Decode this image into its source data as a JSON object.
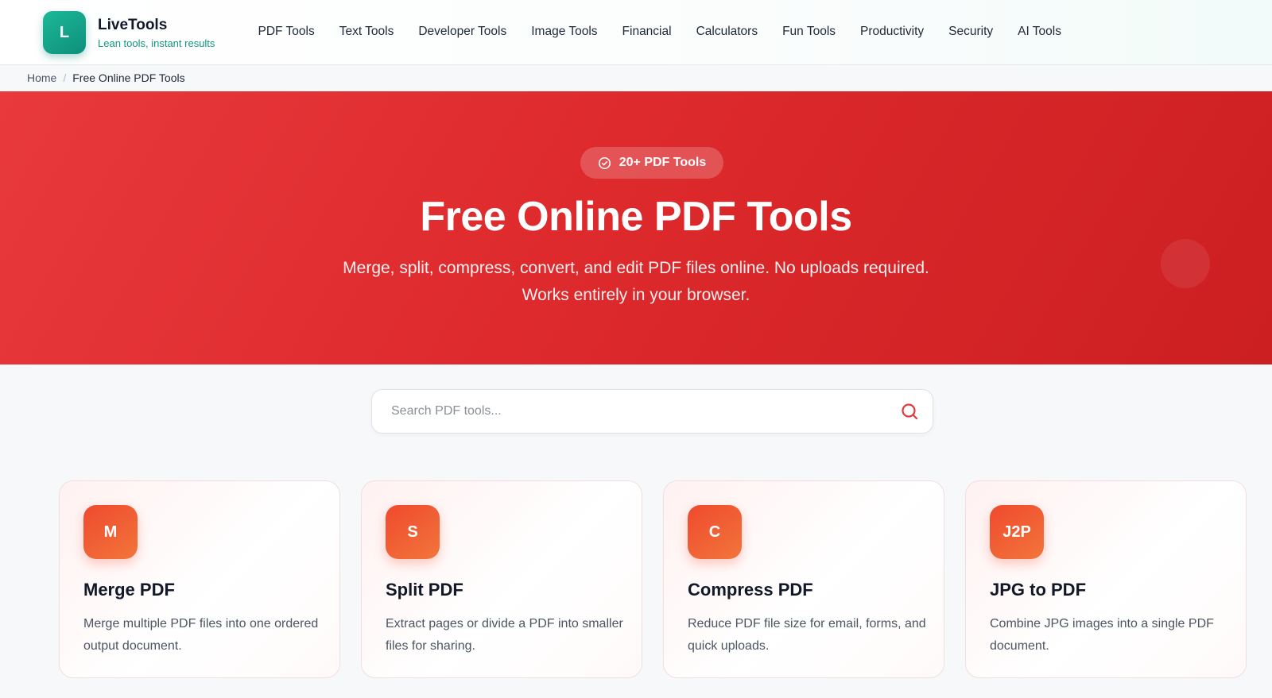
{
  "brand": {
    "logo_letter": "L",
    "name": "LiveTools",
    "tagline": "Lean tools, instant results",
    "accent_color": "#14967f"
  },
  "nav": {
    "items": [
      "PDF Tools",
      "Text Tools",
      "Developer Tools",
      "Image Tools",
      "Financial",
      "Calculators",
      "Fun Tools",
      "Productivity",
      "Security",
      "AI Tools"
    ]
  },
  "breadcrumb": {
    "home": "Home",
    "separator": "/",
    "current": "Free Online PDF Tools"
  },
  "hero": {
    "badge_icon": "check-circle-icon",
    "badge": "20+ PDF Tools",
    "title": "Free Online PDF Tools",
    "subtitle_line1": "Merge, split, compress, convert, and edit PDF files online. No uploads required.",
    "subtitle_line2": "Works entirely in your browser.",
    "background_color": "#de2a2c"
  },
  "search": {
    "placeholder": "Search PDF tools...",
    "value": "",
    "icon": "search-icon",
    "icon_color": "#e5393b"
  },
  "tools": [
    {
      "icon_text": "M",
      "title": "Merge PDF",
      "description": "Merge multiple PDF files into one ordered output document."
    },
    {
      "icon_text": "S",
      "title": "Split PDF",
      "description": "Extract pages or divide a PDF into smaller files for sharing."
    },
    {
      "icon_text": "C",
      "title": "Compress PDF",
      "description": "Reduce PDF file size for email, forms, and quick uploads."
    },
    {
      "icon_text": "J2P",
      "title": "JPG to PDF",
      "description": "Combine JPG images into a single PDF document."
    }
  ]
}
